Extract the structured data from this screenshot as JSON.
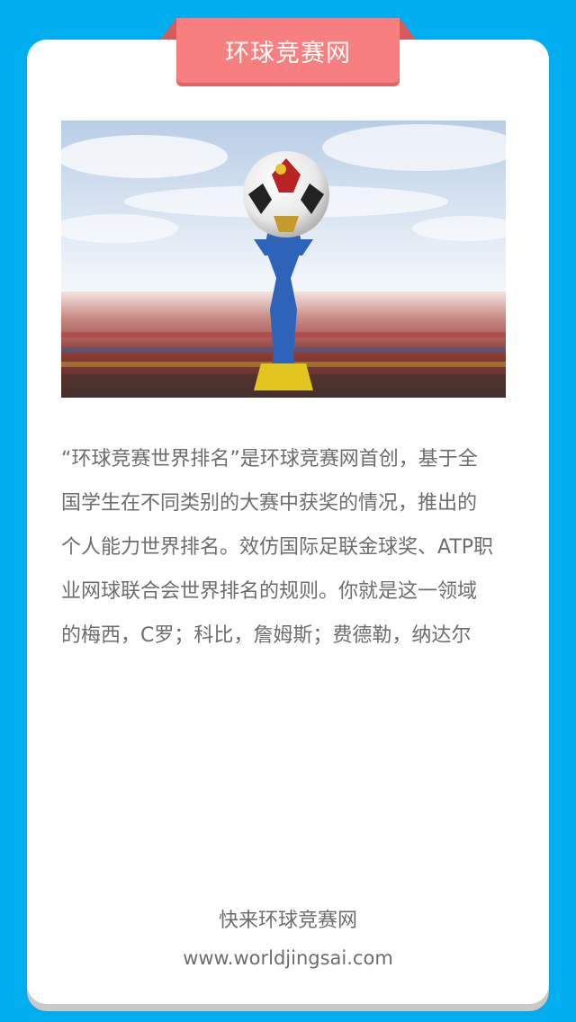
{
  "header": {
    "title": "环球竞赛网"
  },
  "hero": {
    "alt": "football world ranking banner"
  },
  "intro": {
    "lines": [
      "“环球竞赛世界排名”是环球竞赛网首创，基于全",
      "国学生在不同类别的大赛中获奖的情况，推出的",
      "个人能力世界排名。效仿国际足联金球奖、ATP职",
      "业网球联合会世界排名的规则。你就是这一领域",
      "的梅西，C罗；科比，詹姆斯；费德勒，纳达尔"
    ]
  },
  "footer": {
    "cta": "快来环球竞赛网",
    "url": "www.worldjingsai.com"
  },
  "colors": {
    "background": "#00aeef",
    "ribbon": "#f77f7f",
    "card": "#ffffff",
    "text": "#6d6d6d"
  }
}
